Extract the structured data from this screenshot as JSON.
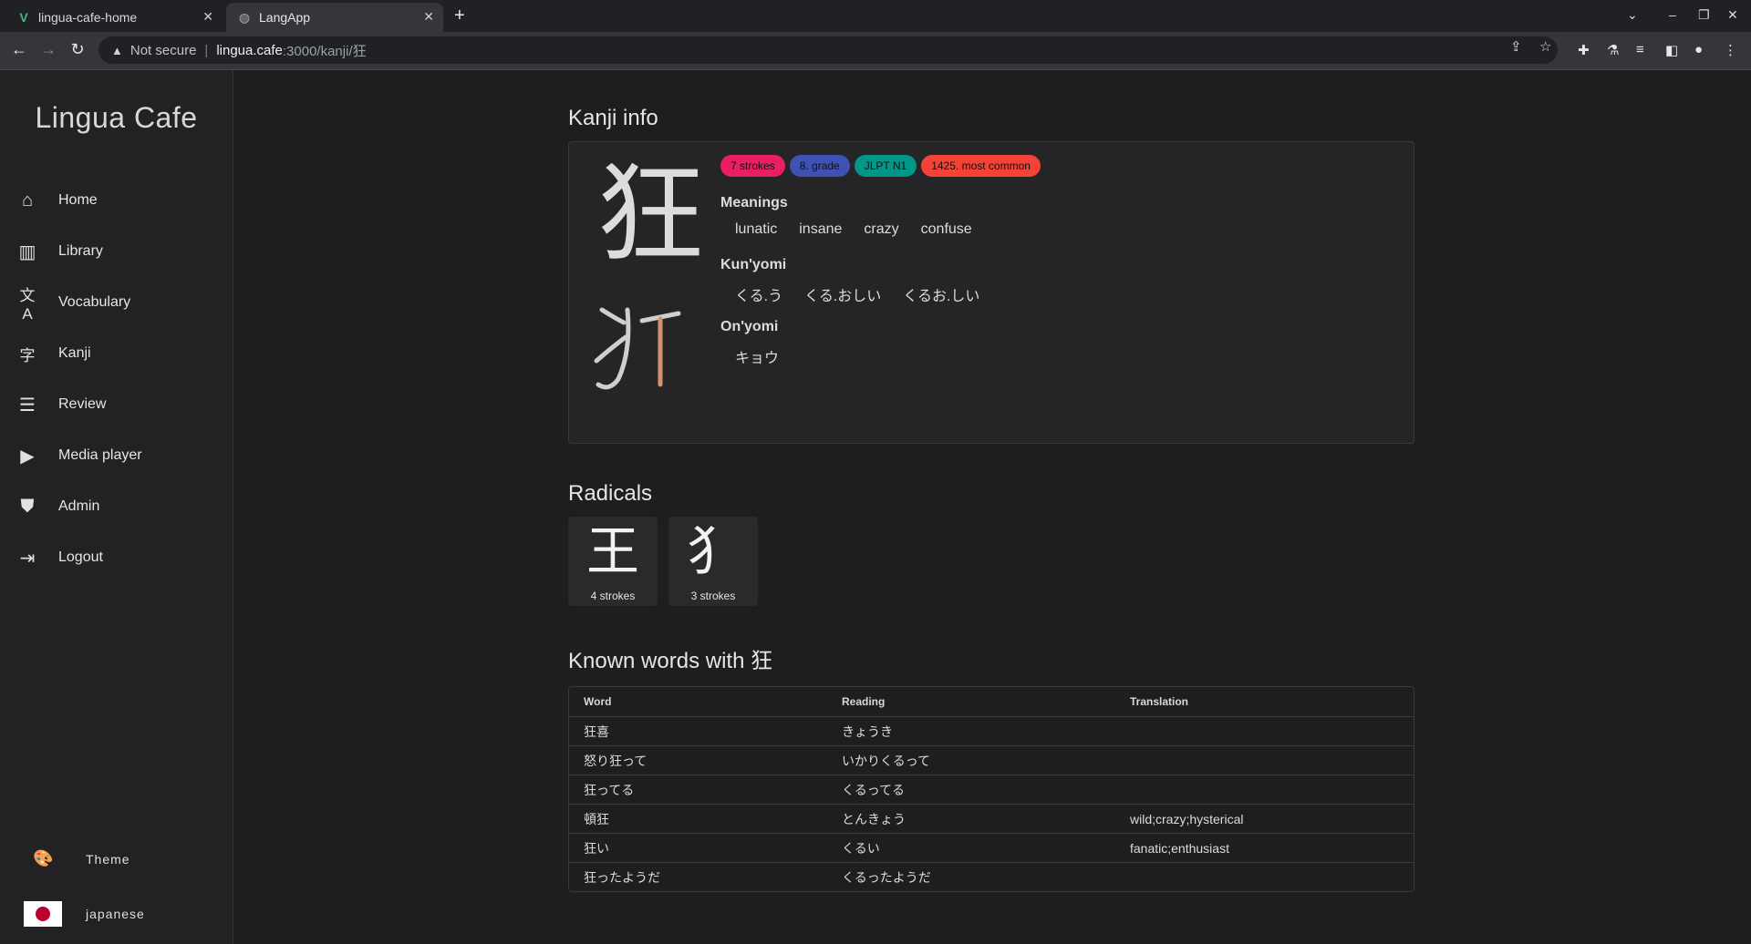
{
  "browser": {
    "tabs": [
      {
        "title": "lingua-cafe-home",
        "active": false,
        "icon": "vue-logo-icon"
      },
      {
        "title": "LangApp",
        "active": true,
        "icon": "globe-icon"
      }
    ],
    "url_security": "Not secure",
    "url_host": "lingua.cafe",
    "url_path": ":3000/kanji/狂"
  },
  "sidebar": {
    "brand": "Lingua Cafe",
    "items": [
      {
        "label": "Home",
        "icon": "home-icon"
      },
      {
        "label": "Library",
        "icon": "library-icon"
      },
      {
        "label": "Vocabulary",
        "icon": "translate-icon"
      },
      {
        "label": "Kanji",
        "icon": "kanji-icon"
      },
      {
        "label": "Review",
        "icon": "review-icon"
      },
      {
        "label": "Media player",
        "icon": "media-player-icon"
      },
      {
        "label": "Admin",
        "icon": "shield-icon"
      },
      {
        "label": "Logout",
        "icon": "logout-icon"
      }
    ],
    "theme_label": "Theme",
    "language_label": "japanese"
  },
  "kanji_info": {
    "heading": "Kanji info",
    "kanji": "狂",
    "chips": [
      {
        "label": "7 strokes",
        "color": "#e91e63"
      },
      {
        "label": "8. grade",
        "color": "#3f51b5"
      },
      {
        "label": "JLPT N1",
        "color": "#009688"
      },
      {
        "label": "1425. most common",
        "color": "#f44336"
      }
    ],
    "meanings_label": "Meanings",
    "meanings": [
      "lunatic",
      "insane",
      "crazy",
      "confuse"
    ],
    "kunyomi_label": "Kun'yomi",
    "kunyomi": [
      "くる.う",
      "くる.おしい",
      "くるお.しい"
    ],
    "onyomi_label": "On'yomi",
    "onyomi": [
      "キョウ"
    ]
  },
  "radicals": {
    "heading": "Radicals",
    "items": [
      {
        "char": "王",
        "strokes": "4 strokes"
      },
      {
        "char": "犭",
        "strokes": "3 strokes"
      }
    ]
  },
  "known_words": {
    "heading": "Known words with 狂",
    "columns": [
      "Word",
      "Reading",
      "Translation"
    ],
    "rows": [
      [
        "狂喜",
        "きょうき",
        ""
      ],
      [
        "怒り狂って",
        "いかりくるって",
        ""
      ],
      [
        "狂ってる",
        "くるってる",
        ""
      ],
      [
        "頓狂",
        "とんきょう",
        "wild;crazy;hysterical"
      ],
      [
        "狂い",
        "くるい",
        "fanatic;enthusiast"
      ],
      [
        "狂ったようだ",
        "くるったようだ",
        ""
      ]
    ]
  }
}
